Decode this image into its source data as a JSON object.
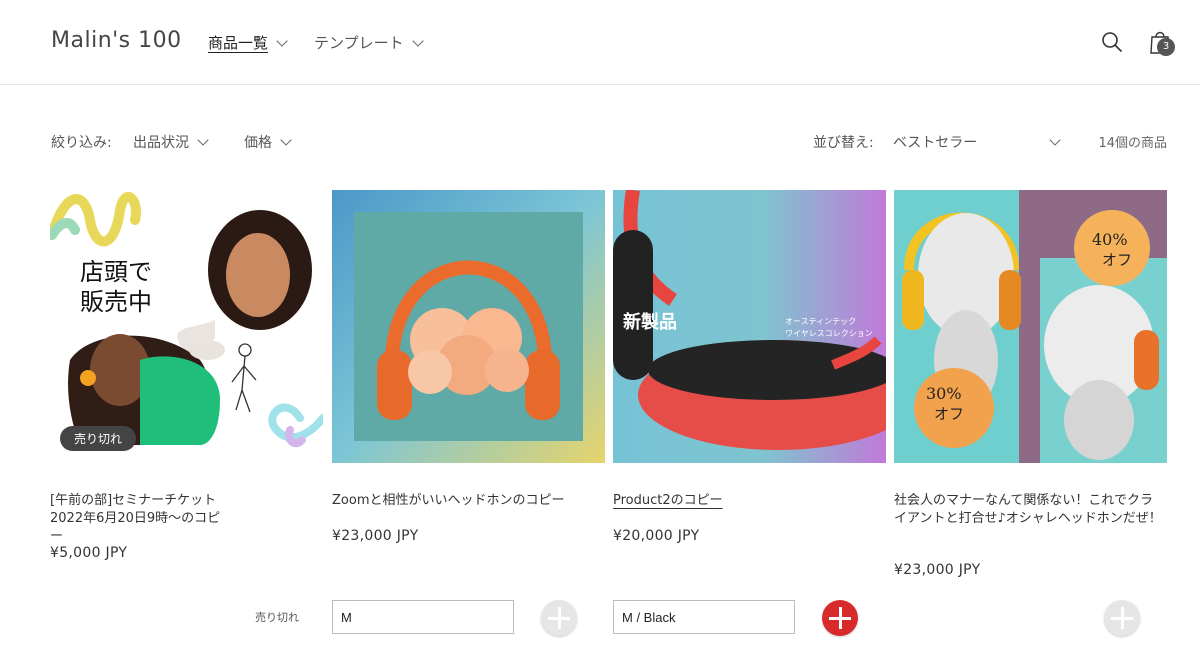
{
  "header": {
    "logo": "Malin's 100",
    "nav": [
      {
        "label": "商品一覧",
        "active": true
      },
      {
        "label": "テンプレート",
        "active": false
      }
    ],
    "cart_count": "3"
  },
  "filters": {
    "label": "絞り込み:",
    "availability": "出品状況",
    "price": "価格",
    "sort_label": "並び替え:",
    "sort_value": "ベストセラー",
    "count": "14個の商品"
  },
  "products": [
    {
      "title": "[午前の部]セミナーチケット　2022年6月20日9時〜のコピー",
      "price": "¥5,000 JPY",
      "badge": "売り切れ",
      "image_text": [
        "店頭で",
        "販売中"
      ],
      "soldout_label": "売り切れ"
    },
    {
      "title": "Zoomと相性がいいヘッドホンのコピー",
      "price": "¥23,000 JPY",
      "variant": "M"
    },
    {
      "title": "Product2のコピー",
      "price": "¥20,000 JPY",
      "variant": "M / Black",
      "image_text": [
        "新製品",
        "オースティンテック",
        "ワイヤレスコレクション"
      ]
    },
    {
      "title": "社会人のマナーなんて関係ない！これでクライアントと打合せ♪オシャレヘッドホンだぜ！",
      "price": "¥23,000 JPY",
      "image_text": [
        "40%",
        "オフ",
        "30%",
        "オフ"
      ]
    }
  ],
  "colors": {
    "add_enabled": "#d82a2a",
    "add_disabled": "#e6e6e6"
  }
}
